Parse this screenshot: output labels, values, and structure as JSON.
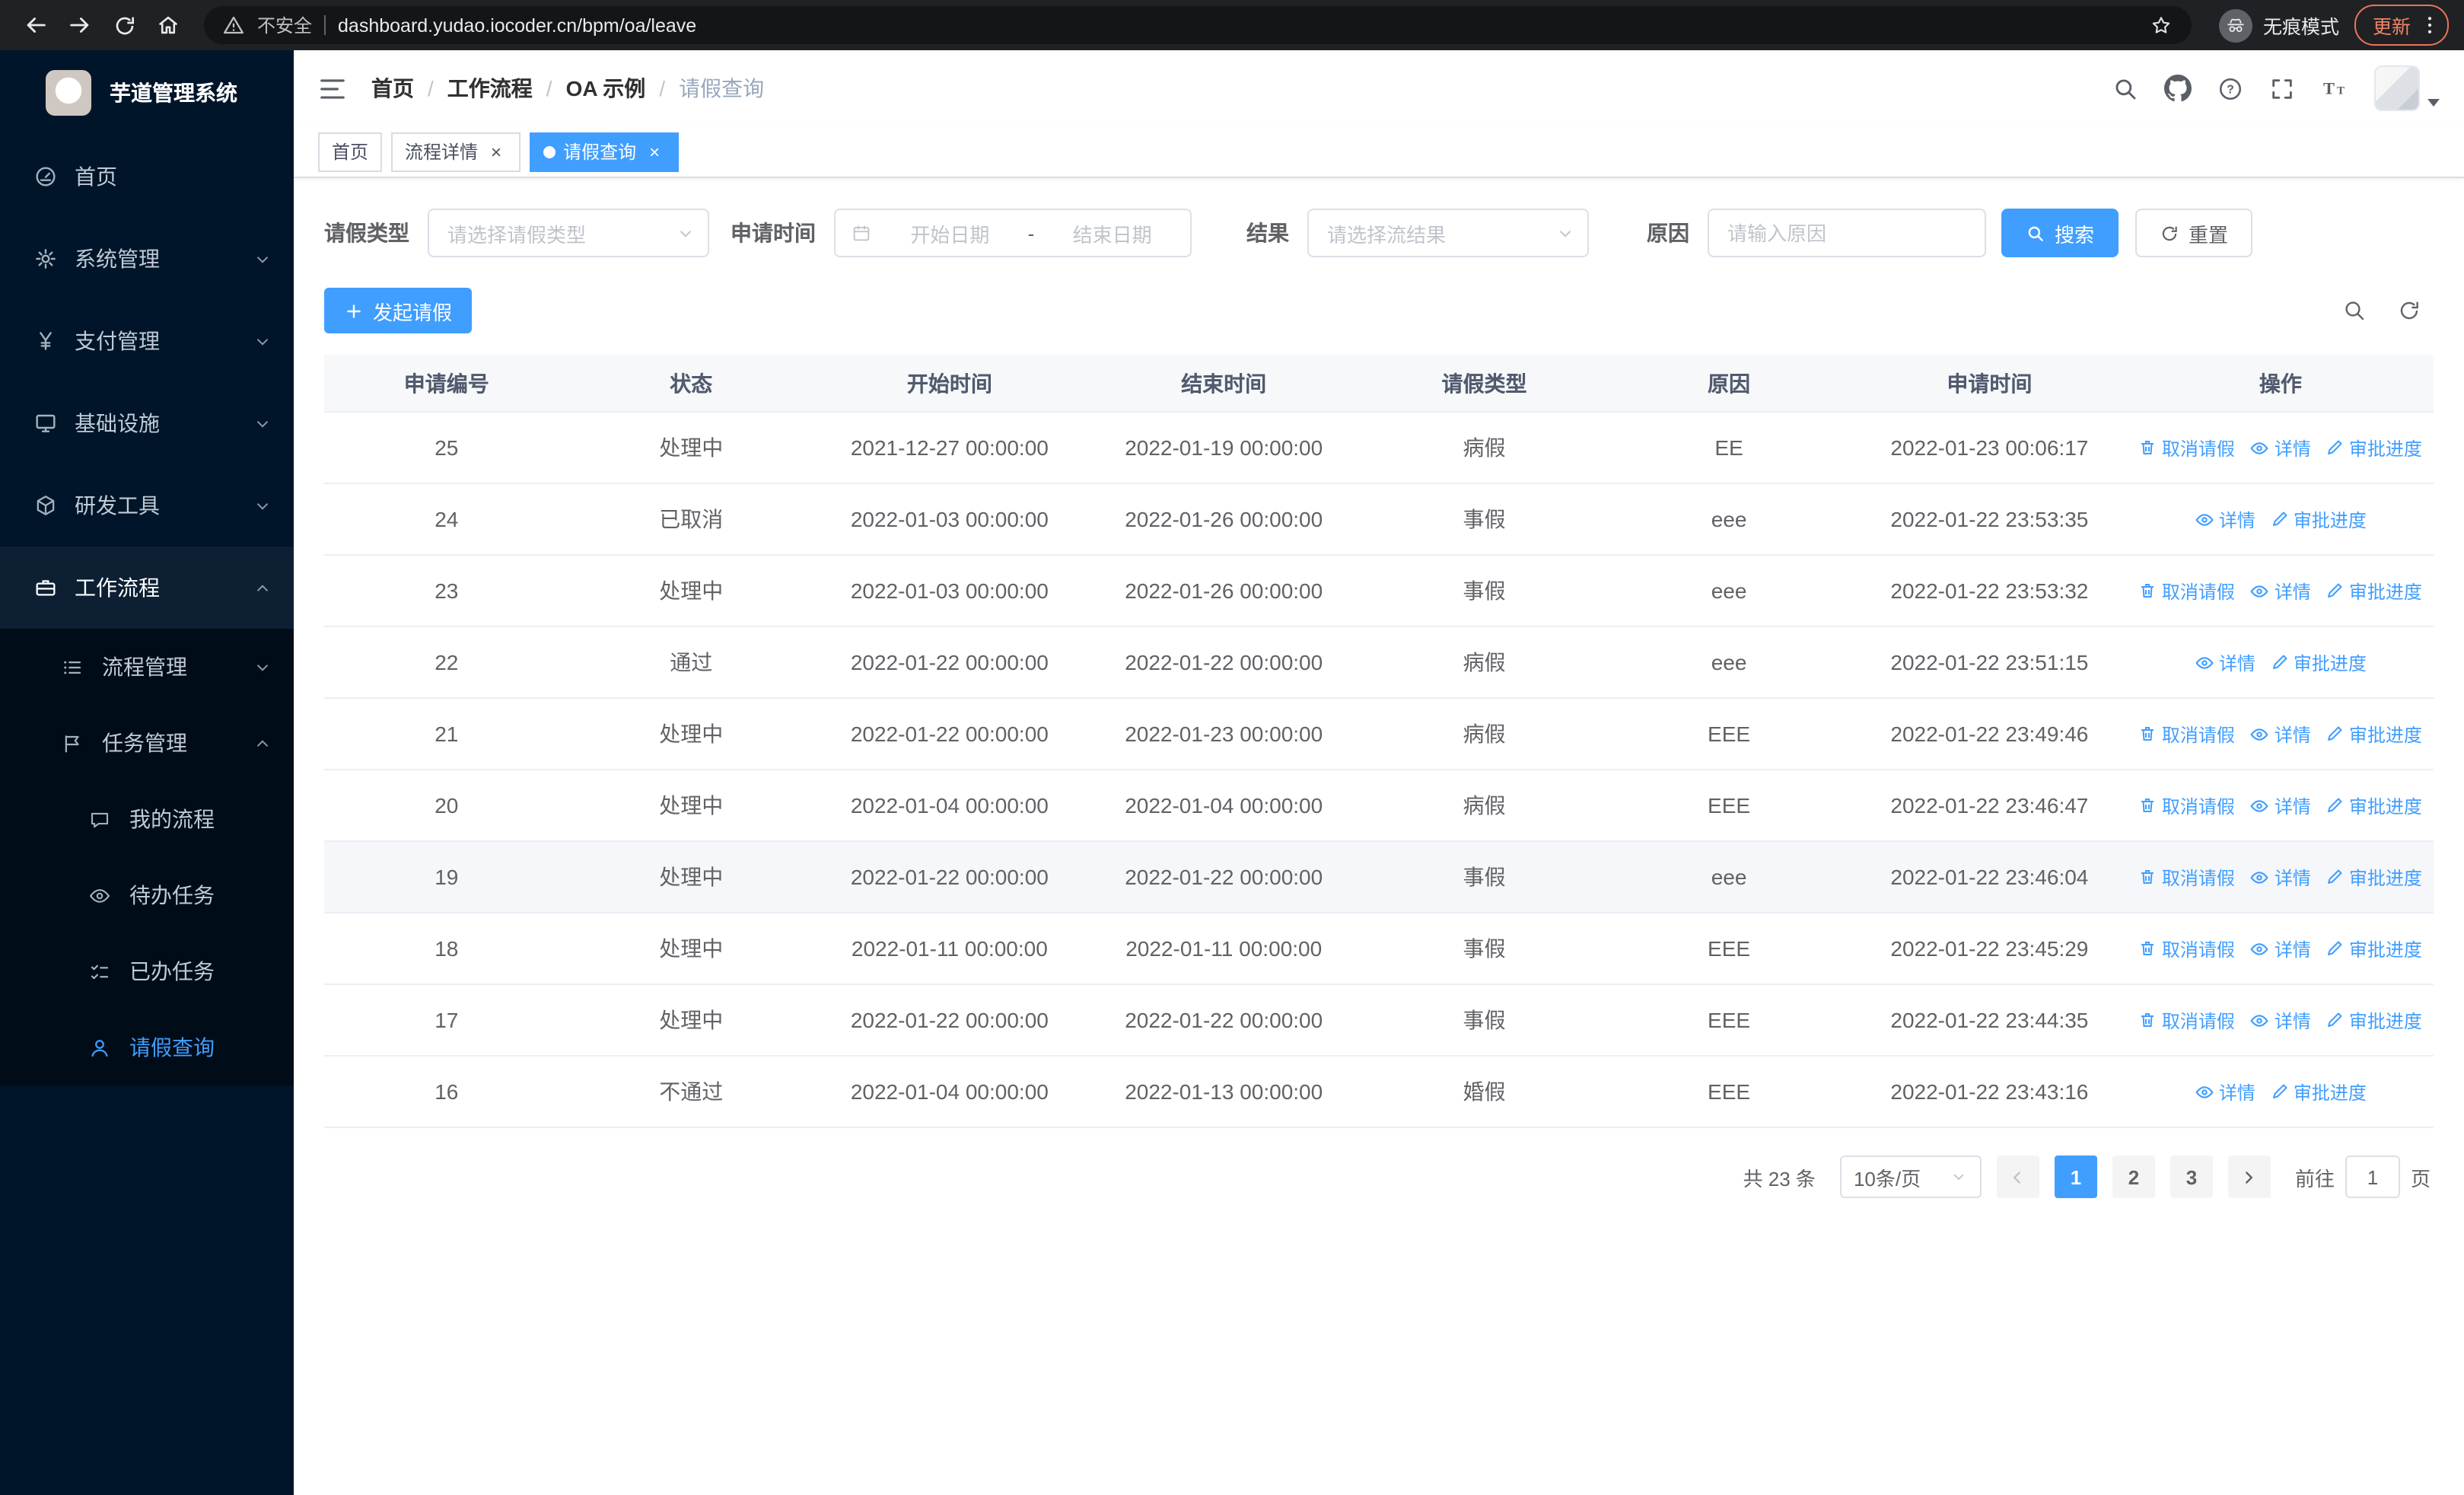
{
  "browser": {
    "security_label": "不安全",
    "url": "dashboard.yudao.iocoder.cn/bpm/oa/leave",
    "incognito_label": "无痕模式",
    "update_label": "更新"
  },
  "sidebar": {
    "logo_title": "芋道管理系统",
    "top_items": [
      {
        "label": "首页",
        "icon": "dashboard-icon"
      },
      {
        "label": "系统管理",
        "icon": "gear-icon"
      },
      {
        "label": "支付管理",
        "icon": "yen-icon"
      },
      {
        "label": "基础设施",
        "icon": "monitor-icon"
      },
      {
        "label": "研发工具",
        "icon": "cube-icon"
      },
      {
        "label": "工作流程",
        "icon": "briefcase-icon",
        "expanded": true
      }
    ],
    "workflow_submenu": [
      {
        "label": "流程管理",
        "icon": "list-icon"
      },
      {
        "label": "任务管理",
        "icon": "flag-icon",
        "expanded": true
      }
    ],
    "task_submenu": [
      {
        "label": "我的流程",
        "icon": "chat-icon"
      },
      {
        "label": "待办任务",
        "icon": "eye-icon"
      },
      {
        "label": "已办任务",
        "icon": "checklist-icon"
      },
      {
        "label": "请假查询",
        "icon": "person-icon",
        "active": true
      }
    ]
  },
  "header": {
    "breadcrumb": [
      "首页",
      "工作流程",
      "OA 示例",
      "请假查询"
    ]
  },
  "tabs": [
    {
      "label": "首页",
      "closable": false,
      "active": false
    },
    {
      "label": "流程详情",
      "closable": true,
      "active": false
    },
    {
      "label": "请假查询",
      "closable": true,
      "active": true
    }
  ],
  "filters": {
    "leave_type_label": "请假类型",
    "leave_type_placeholder": "请选择请假类型",
    "apply_time_label": "申请时间",
    "start_date_placeholder": "开始日期",
    "range_separator": "-",
    "end_date_placeholder": "结束日期",
    "result_label": "结果",
    "result_placeholder": "请选择流结果",
    "reason_label": "原因",
    "reason_placeholder": "请输入原因",
    "search_button": "搜索",
    "reset_button": "重置"
  },
  "toolbar": {
    "create_button": "发起请假"
  },
  "table": {
    "columns": [
      "申请编号",
      "状态",
      "开始时间",
      "结束时间",
      "请假类型",
      "原因",
      "申请时间",
      "操作"
    ],
    "action_labels": {
      "cancel": "取消请假",
      "detail": "详情",
      "progress": "审批进度"
    },
    "rows": [
      {
        "id": "25",
        "status": "处理中",
        "start": "2021-12-27 00:00:00",
        "end": "2022-01-19 00:00:00",
        "type": "病假",
        "reason": "EE",
        "applied": "2022-01-23 00:06:17",
        "actions": [
          "cancel",
          "detail",
          "progress"
        ],
        "highlight": false
      },
      {
        "id": "24",
        "status": "已取消",
        "start": "2022-01-03 00:00:00",
        "end": "2022-01-26 00:00:00",
        "type": "事假",
        "reason": "eee",
        "applied": "2022-01-22 23:53:35",
        "actions": [
          "detail",
          "progress"
        ],
        "highlight": false
      },
      {
        "id": "23",
        "status": "处理中",
        "start": "2022-01-03 00:00:00",
        "end": "2022-01-26 00:00:00",
        "type": "事假",
        "reason": "eee",
        "applied": "2022-01-22 23:53:32",
        "actions": [
          "cancel",
          "detail",
          "progress"
        ],
        "highlight": false
      },
      {
        "id": "22",
        "status": "通过",
        "start": "2022-01-22 00:00:00",
        "end": "2022-01-22 00:00:00",
        "type": "病假",
        "reason": "eee",
        "applied": "2022-01-22 23:51:15",
        "actions": [
          "detail",
          "progress"
        ],
        "highlight": false
      },
      {
        "id": "21",
        "status": "处理中",
        "start": "2022-01-22 00:00:00",
        "end": "2022-01-23 00:00:00",
        "type": "病假",
        "reason": "EEE",
        "applied": "2022-01-22 23:49:46",
        "actions": [
          "cancel",
          "detail",
          "progress"
        ],
        "highlight": false
      },
      {
        "id": "20",
        "status": "处理中",
        "start": "2022-01-04 00:00:00",
        "end": "2022-01-04 00:00:00",
        "type": "病假",
        "reason": "EEE",
        "applied": "2022-01-22 23:46:47",
        "actions": [
          "cancel",
          "detail",
          "progress"
        ],
        "highlight": false
      },
      {
        "id": "19",
        "status": "处理中",
        "start": "2022-01-22 00:00:00",
        "end": "2022-01-22 00:00:00",
        "type": "事假",
        "reason": "eee",
        "applied": "2022-01-22 23:46:04",
        "actions": [
          "cancel",
          "detail",
          "progress"
        ],
        "highlight": true
      },
      {
        "id": "18",
        "status": "处理中",
        "start": "2022-01-11 00:00:00",
        "end": "2022-01-11 00:00:00",
        "type": "事假",
        "reason": "EEE",
        "applied": "2022-01-22 23:45:29",
        "actions": [
          "cancel",
          "detail",
          "progress"
        ],
        "highlight": false
      },
      {
        "id": "17",
        "status": "处理中",
        "start": "2022-01-22 00:00:00",
        "end": "2022-01-22 00:00:00",
        "type": "事假",
        "reason": "EEE",
        "applied": "2022-01-22 23:44:35",
        "actions": [
          "cancel",
          "detail",
          "progress"
        ],
        "highlight": false
      },
      {
        "id": "16",
        "status": "不通过",
        "start": "2022-01-04 00:00:00",
        "end": "2022-01-13 00:00:00",
        "type": "婚假",
        "reason": "EEE",
        "applied": "2022-01-22 23:43:16",
        "actions": [
          "detail",
          "progress"
        ],
        "highlight": false
      }
    ]
  },
  "pagination": {
    "total_text": "共 23 条",
    "page_size": "10条/页",
    "pages": [
      "1",
      "2",
      "3"
    ],
    "active_page": "1",
    "goto_label": "前往",
    "goto_value": "1",
    "goto_suffix": "页"
  },
  "icons": {
    "search": "magnifier",
    "refresh": "circular-arrow",
    "github": "octocat-mark",
    "help": "question-circle",
    "fullscreen": "corner-brackets",
    "font_size": "double-T",
    "cancel_action": "trash",
    "detail_action": "eye",
    "progress_action": "pencil"
  },
  "colors": {
    "primary": "#409eff",
    "sidebar_bg": "#001529",
    "submenu_bg": "#000c17",
    "update_accent": "#f08566",
    "table_border": "#ebeef5",
    "row_highlight": "#f5f7fa"
  }
}
